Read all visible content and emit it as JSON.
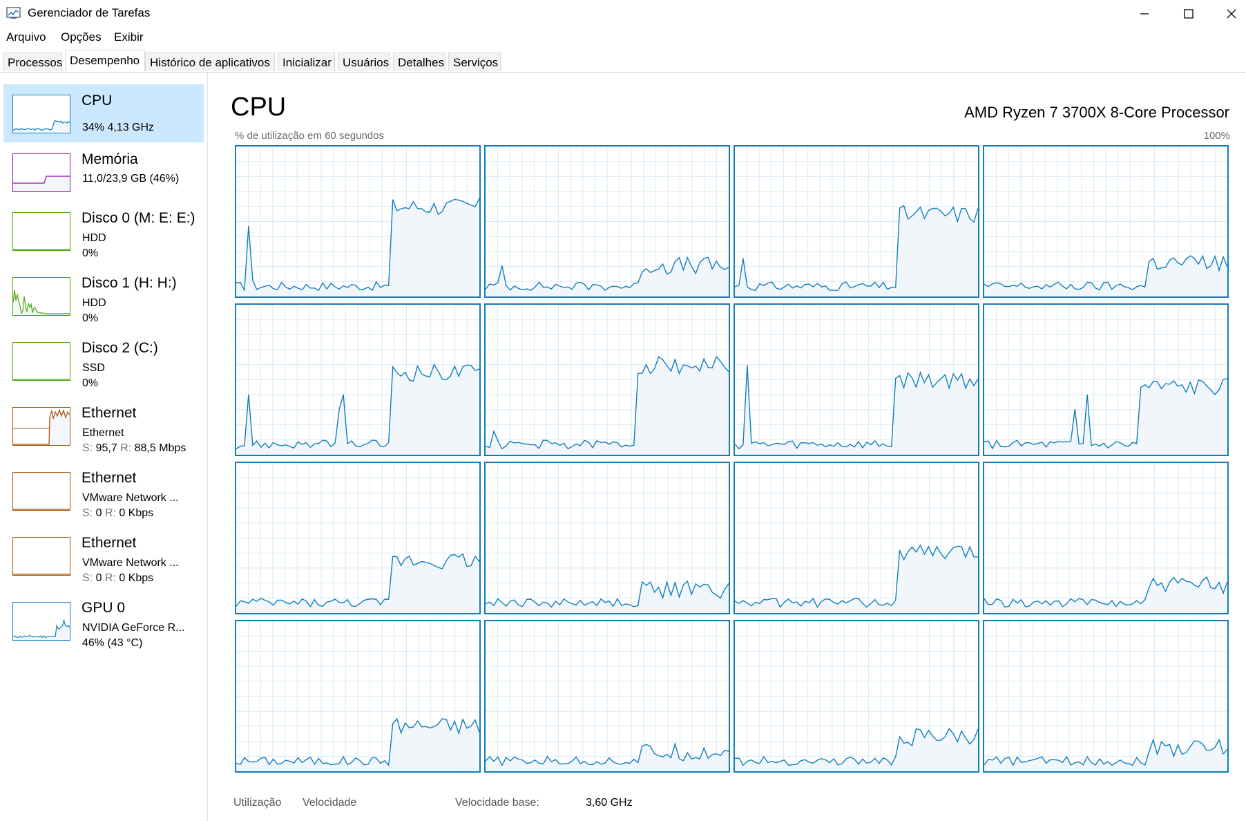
{
  "window": {
    "title": "Gerenciador de Tarefas",
    "icon": "task-manager-icon",
    "controls": [
      "minimize-icon",
      "maximize-icon",
      "close-icon"
    ]
  },
  "menu": [
    "Arquivo",
    "Opções",
    "Exibir"
  ],
  "tabs": [
    "Processos",
    "Desempenho",
    "Histórico de aplicativos",
    "Inicializar",
    "Usuários",
    "Detalhes",
    "Serviços"
  ],
  "active_tab": "Desempenho",
  "sidebar": [
    {
      "name": "CPU",
      "line1": "34% 4,13 GHz",
      "line2": "",
      "color": "#117dbb",
      "selected": true
    },
    {
      "name": "Memória",
      "line1": "11,0/23,9 GB (46%)",
      "line2": "",
      "color": "#8b12ae"
    },
    {
      "name": "Disco 0 (M: E: E:)",
      "line1": "HDD",
      "line2": "0%",
      "color": "#4da60c"
    },
    {
      "name": "Disco 1 (H: H:)",
      "line1": "HDD",
      "line2": "0%",
      "color": "#4da60c"
    },
    {
      "name": "Disco 2 (C:)",
      "line1": "SSD",
      "line2": "0%",
      "color": "#4da60c"
    },
    {
      "name": "Ethernet",
      "line1": "Ethernet",
      "line2_s": "S:",
      "line2_sv": " 95,7 ",
      "line2_r": "R:",
      "line2_rv": " 88,5 Mbps",
      "color": "#a74f01"
    },
    {
      "name": "Ethernet",
      "line1": "VMware Network ...",
      "line2_s": "S:",
      "line2_sv": " 0 ",
      "line2_r": "R:",
      "line2_rv": " 0 Kbps",
      "color": "#a74f01"
    },
    {
      "name": "Ethernet",
      "line1": "VMware Network ...",
      "line2_s": "S:",
      "line2_sv": " 0 ",
      "line2_r": "R:",
      "line2_rv": " 0 Kbps",
      "color": "#a74f01"
    },
    {
      "name": "GPU 0",
      "line1": "NVIDIA GeForce R...",
      "line2": "46% (43 °C)",
      "color": "#117dbb"
    }
  ],
  "main": {
    "title": "CPU",
    "processor": "AMD Ryzen 7 3700X 8-Core Processor",
    "util_label": "% de utilização em 60 segundos",
    "max_label": "100%",
    "core_count": 16,
    "line_color": "#117dbb",
    "fill_color": "#f1f6fb",
    "grid_color": "#d9eaf4"
  },
  "stats": {
    "utilizacao_label": "Utilização",
    "velocidade_label": "Velocidade",
    "velocidade_base_label": "Velocidade base:",
    "velocidade_base_value": "3,60 GHz"
  }
}
